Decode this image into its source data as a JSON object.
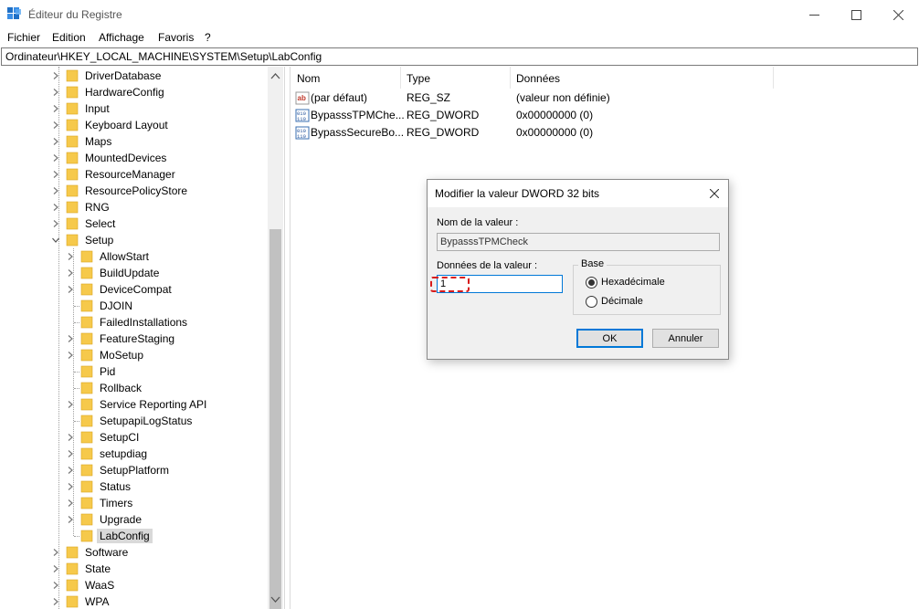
{
  "window": {
    "title": "Éditeur du Registre"
  },
  "menu": [
    "Fichier",
    "Edition",
    "Affichage",
    "Favoris",
    "?"
  ],
  "address": "Ordinateur\\HKEY_LOCAL_MACHINE\\SYSTEM\\Setup\\LabConfig",
  "tree": {
    "top_level": [
      "DriverDatabase",
      "HardwareConfig",
      "Input",
      "Keyboard Layout",
      "Maps",
      "MountedDevices",
      "ResourceManager",
      "ResourcePolicyStore",
      "RNG",
      "Select",
      "Setup"
    ],
    "setup_children": [
      "AllowStart",
      "BuildUpdate",
      "DeviceCompat",
      "DJOIN",
      "FailedInstallations",
      "FeatureStaging",
      "MoSetup",
      "Pid",
      "Rollback",
      "Service Reporting API",
      "SetupapiLogStatus",
      "SetupCI",
      "setupdiag",
      "SetupPlatform",
      "Status",
      "Timers",
      "Upgrade",
      "LabConfig"
    ],
    "after_setup": [
      "Software",
      "State",
      "WaaS",
      "WPA"
    ],
    "selected": "LabConfig"
  },
  "list": {
    "headers": {
      "name": "Nom",
      "type": "Type",
      "data": "Données"
    },
    "rows": [
      {
        "icon": "string-value-icon",
        "name": "(par défaut)",
        "type": "REG_SZ",
        "data": "(valeur non définie)"
      },
      {
        "icon": "binary-value-icon",
        "name": "BypasssTPMChe...",
        "type": "REG_DWORD",
        "data": "0x00000000 (0)"
      },
      {
        "icon": "binary-value-icon",
        "name": "BypassSecureBo...",
        "type": "REG_DWORD",
        "data": "0x00000000 (0)"
      }
    ]
  },
  "dialog": {
    "title": "Modifier la valeur DWORD 32 bits",
    "value_name_label": "Nom de la valeur :",
    "value_name": "BypasssTPMCheck",
    "value_data_label": "Données de la valeur :",
    "value_data": "1",
    "base_label": "Base",
    "base_options": [
      {
        "label": "Hexadécimale",
        "checked": true
      },
      {
        "label": "Décimale",
        "checked": false
      }
    ],
    "ok_label": "OK",
    "cancel_label": "Annuler"
  },
  "colors": {
    "folder": "#f6c94b",
    "accent": "#0078d7",
    "highlight": "#d81b1b"
  }
}
